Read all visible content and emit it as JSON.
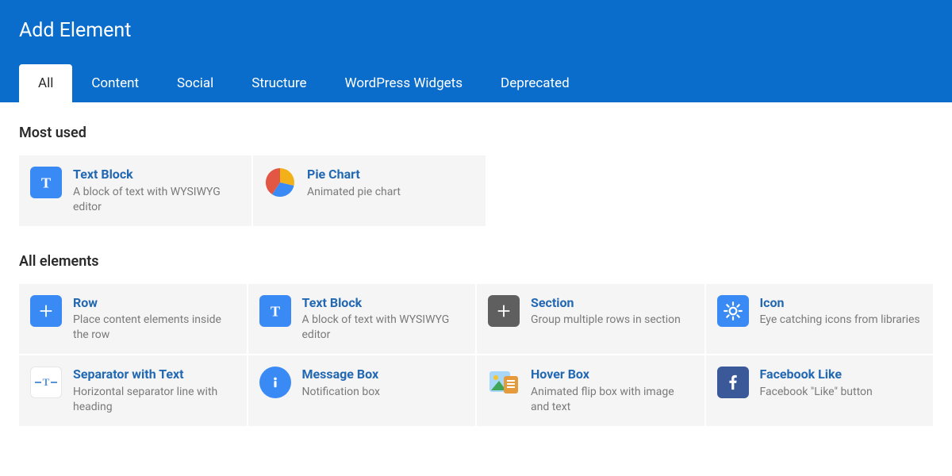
{
  "header": {
    "title": "Add Element"
  },
  "tabs": [
    {
      "label": "All",
      "active": true
    },
    {
      "label": "Content",
      "active": false
    },
    {
      "label": "Social",
      "active": false
    },
    {
      "label": "Structure",
      "active": false
    },
    {
      "label": "WordPress Widgets",
      "active": false
    },
    {
      "label": "Deprecated",
      "active": false
    }
  ],
  "sections": {
    "most_used": {
      "title": "Most used",
      "items": [
        {
          "title": "Text Block",
          "subtitle": "A block of text with WYSIWYG editor",
          "icon": "text-block"
        },
        {
          "title": "Pie Chart",
          "subtitle": "Animated pie chart",
          "icon": "pie-chart"
        }
      ]
    },
    "all_elements": {
      "title": "All elements",
      "items": [
        {
          "title": "Row",
          "subtitle": "Place content elements inside the row",
          "icon": "row"
        },
        {
          "title": "Text Block",
          "subtitle": "A block of text with WYSIWYG editor",
          "icon": "text-block"
        },
        {
          "title": "Section",
          "subtitle": "Group multiple rows in section",
          "icon": "section"
        },
        {
          "title": "Icon",
          "subtitle": "Eye catching icons from libraries",
          "icon": "icon"
        },
        {
          "title": "Separator with Text",
          "subtitle": "Horizontal separator line with heading",
          "icon": "separator"
        },
        {
          "title": "Message Box",
          "subtitle": "Notification box",
          "icon": "message"
        },
        {
          "title": "Hover Box",
          "subtitle": "Animated flip box with image and text",
          "icon": "hover-box"
        },
        {
          "title": "Facebook Like",
          "subtitle": "Facebook \"Like\" button",
          "icon": "facebook"
        }
      ]
    }
  }
}
